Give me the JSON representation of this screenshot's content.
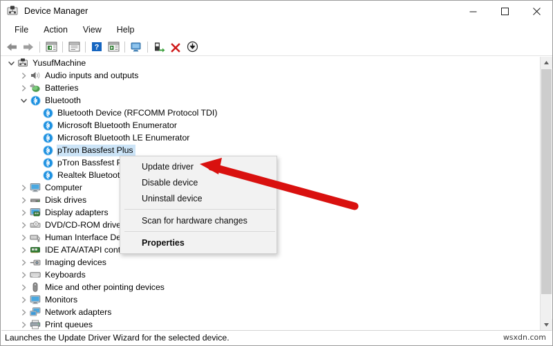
{
  "window": {
    "title": "Device Manager",
    "icon": "device-manager-icon",
    "controls": {
      "minimize": "—",
      "maximize": "□",
      "close": "✕"
    }
  },
  "menubar": {
    "items": [
      {
        "label": "File"
      },
      {
        "label": "Action"
      },
      {
        "label": "View"
      },
      {
        "label": "Help"
      }
    ]
  },
  "toolbar": {
    "buttons": [
      {
        "name": "back-icon"
      },
      {
        "name": "forward-icon"
      },
      {
        "name": "separator"
      },
      {
        "name": "show-hide-console-tree-icon"
      },
      {
        "name": "separator"
      },
      {
        "name": "properties-icon"
      },
      {
        "name": "separator"
      },
      {
        "name": "help-icon"
      },
      {
        "name": "update-driver-toolbar-icon"
      },
      {
        "name": "separator"
      },
      {
        "name": "scan-for-hardware-changes-icon"
      },
      {
        "name": "separator"
      },
      {
        "name": "enable-device-icon"
      },
      {
        "name": "uninstall-device-icon"
      },
      {
        "name": "update-driver-download-icon"
      }
    ]
  },
  "tree": {
    "nodes": [
      {
        "label": "YusufMachine",
        "level": 0,
        "twisty": "expanded",
        "icon": "computer-root-icon",
        "selected": false
      },
      {
        "label": "Audio inputs and outputs",
        "level": 1,
        "twisty": "collapsed",
        "icon": "speaker-icon",
        "selected": false
      },
      {
        "label": "Batteries",
        "level": 1,
        "twisty": "collapsed",
        "icon": "battery-icon",
        "selected": false
      },
      {
        "label": "Bluetooth",
        "level": 1,
        "twisty": "expanded",
        "icon": "bluetooth-icon",
        "selected": false
      },
      {
        "label": "Bluetooth Device (RFCOMM Protocol TDI)",
        "level": 2,
        "twisty": "none",
        "icon": "bluetooth-icon",
        "selected": false
      },
      {
        "label": "Microsoft Bluetooth Enumerator",
        "level": 2,
        "twisty": "none",
        "icon": "bluetooth-icon",
        "selected": false
      },
      {
        "label": "Microsoft Bluetooth LE Enumerator",
        "level": 2,
        "twisty": "none",
        "icon": "bluetooth-icon",
        "selected": false
      },
      {
        "label": "pTron Bassfest Plus",
        "level": 2,
        "twisty": "none",
        "icon": "bluetooth-icon",
        "selected": true
      },
      {
        "label": "pTron Bassfest Plus",
        "level": 2,
        "twisty": "none",
        "icon": "bluetooth-icon",
        "selected": false
      },
      {
        "label": "Realtek Bluetooth Adapter",
        "level": 2,
        "twisty": "none",
        "icon": "bluetooth-icon",
        "selected": false
      },
      {
        "label": "Computer",
        "level": 1,
        "twisty": "collapsed",
        "icon": "monitor-icon",
        "selected": false
      },
      {
        "label": "Disk drives",
        "level": 1,
        "twisty": "collapsed",
        "icon": "disk-drive-icon",
        "selected": false
      },
      {
        "label": "Display adapters",
        "level": 1,
        "twisty": "collapsed",
        "icon": "display-adapter-icon",
        "selected": false
      },
      {
        "label": "DVD/CD-ROM drives",
        "level": 1,
        "twisty": "collapsed",
        "icon": "dvd-drive-icon",
        "selected": false
      },
      {
        "label": "Human Interface Devices",
        "level": 1,
        "twisty": "collapsed",
        "icon": "hid-icon",
        "selected": false
      },
      {
        "label": "IDE ATA/ATAPI controllers",
        "level": 1,
        "twisty": "collapsed",
        "icon": "ide-controller-icon",
        "selected": false
      },
      {
        "label": "Imaging devices",
        "level": 1,
        "twisty": "collapsed",
        "icon": "imaging-device-icon",
        "selected": false
      },
      {
        "label": "Keyboards",
        "level": 1,
        "twisty": "collapsed",
        "icon": "keyboard-icon",
        "selected": false
      },
      {
        "label": "Mice and other pointing devices",
        "level": 1,
        "twisty": "collapsed",
        "icon": "mouse-icon",
        "selected": false
      },
      {
        "label": "Monitors",
        "level": 1,
        "twisty": "collapsed",
        "icon": "monitor-icon",
        "selected": false
      },
      {
        "label": "Network adapters",
        "level": 1,
        "twisty": "collapsed",
        "icon": "network-adapter-icon",
        "selected": false
      },
      {
        "label": "Print queues",
        "level": 1,
        "twisty": "collapsed",
        "icon": "printer-icon",
        "selected": false
      }
    ]
  },
  "context_menu": {
    "items": [
      {
        "label": "Update driver",
        "bold": false,
        "separator_after": false
      },
      {
        "label": "Disable device",
        "bold": false,
        "separator_after": false
      },
      {
        "label": "Uninstall device",
        "bold": false,
        "separator_after": true
      },
      {
        "label": "Scan for hardware changes",
        "bold": false,
        "separator_after": true
      },
      {
        "label": "Properties",
        "bold": true,
        "separator_after": false
      }
    ]
  },
  "annotation": {
    "arrow": "red-arrow-pointing-to-update-driver",
    "color": "#d9110f"
  },
  "statusbar": {
    "text": "Launches the Update Driver Wizard for the selected device.",
    "watermark": "wsxdn.com"
  },
  "colors": {
    "selection": "#cce4f7",
    "bluetooth_blue": "#1a8fe0",
    "accent_red": "#d9110f",
    "menu_bg": "#f2f2f2"
  }
}
